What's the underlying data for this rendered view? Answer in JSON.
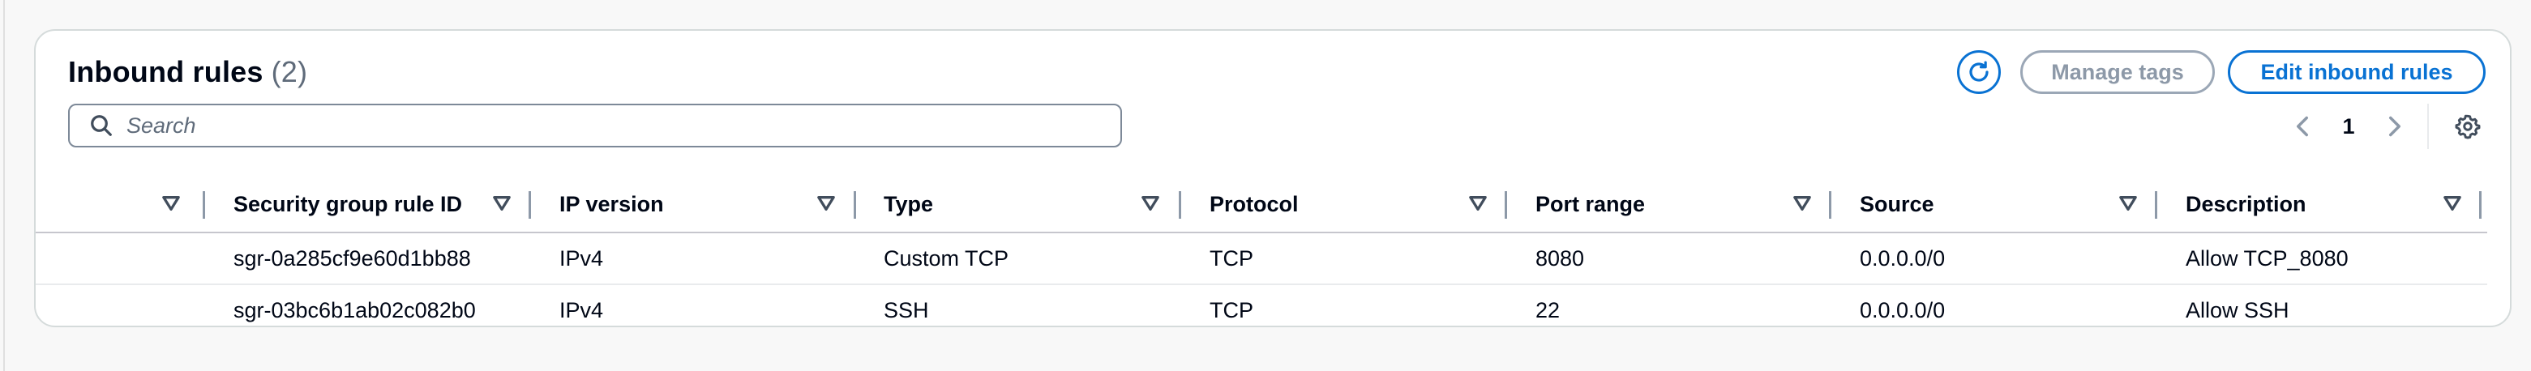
{
  "header": {
    "title": "Inbound rules",
    "count": "(2)"
  },
  "actions": {
    "refresh_icon": "refresh-icon",
    "manage_tags_label": "Manage tags",
    "edit_inbound_rules_label": "Edit inbound rules"
  },
  "search": {
    "placeholder": "Search",
    "icon": "search-icon"
  },
  "pagination": {
    "current_page": "1",
    "prev_icon": "chevron-left-icon",
    "next_icon": "chevron-right-icon",
    "settings_icon": "gear-icon"
  },
  "table": {
    "columns": [
      {
        "label": ""
      },
      {
        "label": "Security group rule ID"
      },
      {
        "label": "IP version"
      },
      {
        "label": "Type"
      },
      {
        "label": "Protocol"
      },
      {
        "label": "Port range"
      },
      {
        "label": "Source"
      },
      {
        "label": "Description"
      }
    ],
    "rows": [
      {
        "rule_id": "sgr-0a285cf9e60d1bb88",
        "ip_version": "IPv4",
        "type": "Custom TCP",
        "protocol": "TCP",
        "port_range": "8080",
        "source": "0.0.0.0/0",
        "description": "Allow TCP_8080"
      },
      {
        "rule_id": "sgr-03bc6b1ab02c082b0",
        "ip_version": "IPv4",
        "type": "SSH",
        "protocol": "TCP",
        "port_range": "22",
        "source": "0.0.0.0/0",
        "description": "Allow SSH"
      }
    ]
  },
  "colors": {
    "accent": "#0972d3",
    "disabled": "#9ba7b6",
    "border": "#d5dbdb",
    "text": "#000716",
    "muted": "#5f6b7a"
  }
}
